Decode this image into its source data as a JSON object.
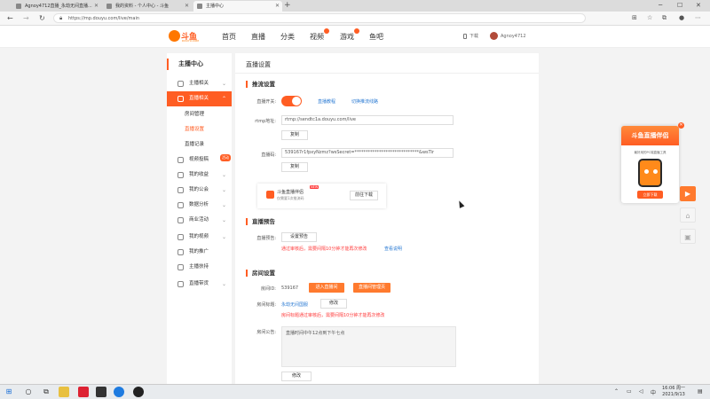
{
  "browser": {
    "tabs": [
      {
        "label": "Agnoy4712直播_永劫无间直播...",
        "active": false
      },
      {
        "label": "我的资料 - 个人中心 - 斗鱼",
        "active": false
      },
      {
        "label": "主播中心",
        "active": true
      }
    ],
    "url": "https://mp.douyu.com/live/main"
  },
  "site": {
    "logo_text": "斗鱼",
    "logo_domain": "DOUYU.COM",
    "nav": [
      "首页",
      "直播",
      "分类",
      "视频",
      "游戏",
      "鱼吧"
    ],
    "download_label": "下载",
    "username": "Agnoy4712"
  },
  "sidebar": {
    "title": "主播中心",
    "items": [
      {
        "label": "主播相关",
        "icon": "mic-icon"
      },
      {
        "label": "直播相关",
        "icon": "screen-icon",
        "active": true
      },
      {
        "label": "视频投稿",
        "icon": "video-icon",
        "badge": "活动"
      },
      {
        "label": "我的收益",
        "icon": "coin-icon"
      },
      {
        "label": "我的公会",
        "icon": "guild-icon"
      },
      {
        "label": "数据分析",
        "icon": "chart-icon"
      },
      {
        "label": "商业活动",
        "icon": "business-icon"
      },
      {
        "label": "我的视频",
        "icon": "film-icon"
      },
      {
        "label": "我的推广",
        "icon": "promo-icon"
      },
      {
        "label": "主播扶持",
        "icon": "support-icon"
      },
      {
        "label": "直播带货",
        "icon": "shop-icon"
      }
    ],
    "subitems": [
      {
        "label": "房间管理",
        "current": false
      },
      {
        "label": "直播设置",
        "current": true
      },
      {
        "label": "直播记录",
        "current": false
      }
    ]
  },
  "main": {
    "title": "直播设置",
    "stream": {
      "section_title": "推流设置",
      "switch_label": "直播开关:",
      "switch_on": true,
      "link_tutorial": "直播教程",
      "link_switch_line": "切换推流线路",
      "rtmp_label": "rtmp地址:",
      "rtmp_value": "rtmp://sendtc1a.douyu.com/live",
      "copy_label": "复制",
      "code_label": "直播码:",
      "code_value": "539167r1fpxyNzmz?wsSecret=*****************************&wsTir",
      "copy2_label": "复制",
      "promo_name": "斗鱼直播伴侣",
      "promo_new": "NEW",
      "promo_desc": "仅需要1次推流码",
      "promo_button": "前往下载"
    },
    "preview": {
      "section_title": "直播预告",
      "label": "直播预告:",
      "button": "设置预告",
      "hint": "通过审核后，需要间隔10分钟才能再次修改",
      "hint_link": "查看说明"
    },
    "room": {
      "section_title": "房间设置",
      "id_label": "房间ID:",
      "id_value": "539167",
      "enter_room": "进入直播间",
      "live_manage": "直播间管理页",
      "title_label": "房间标题:",
      "title_value": "永劫无间国服",
      "title_modify": "修改",
      "title_hint": "房间标题通过审核后，需要间隔10分钟才能再次修改",
      "notice_label": "房间公告:",
      "notice_value": "直播时间中午12点到下午七点",
      "notice_modify": "修改"
    }
  },
  "float_ad": {
    "title": "斗鱼直播伴侣",
    "desc": "最好用的PC端直播工具",
    "cta": "立即下载"
  },
  "taskbar": {
    "time": "16:06 周一",
    "date": "2021/9/13"
  },
  "colors": {
    "brand": "#ff5d23",
    "link": "#2a7ad3",
    "warning": "#ff3a3a"
  }
}
